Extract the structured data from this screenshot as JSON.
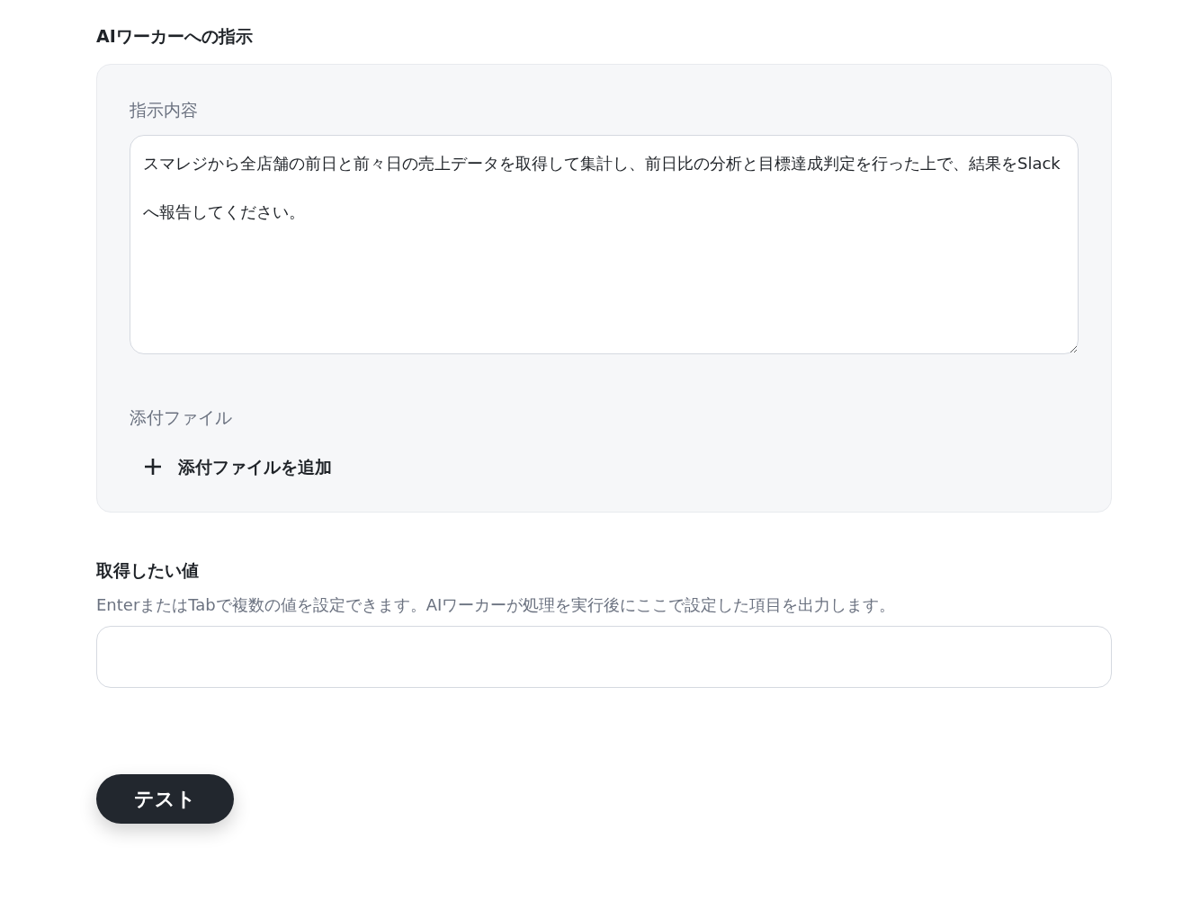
{
  "section_title": "AIワーカーへの指示",
  "instruction": {
    "label": "指示内容",
    "value": "スマレジから全店舗の前日と前々日の売上データを取得して集計し、前日比の分析と目標達成判定を行った上で、結果をSlackへ報告してください。"
  },
  "attachments": {
    "label": "添付ファイル",
    "add_button": "添付ファイルを追加"
  },
  "output_values": {
    "label": "取得したい値",
    "help": "EnterまたはTabで複数の値を設定できます。AIワーカーが処理を実行後にここで設定した項目を出力します。"
  },
  "test_button": "テスト"
}
